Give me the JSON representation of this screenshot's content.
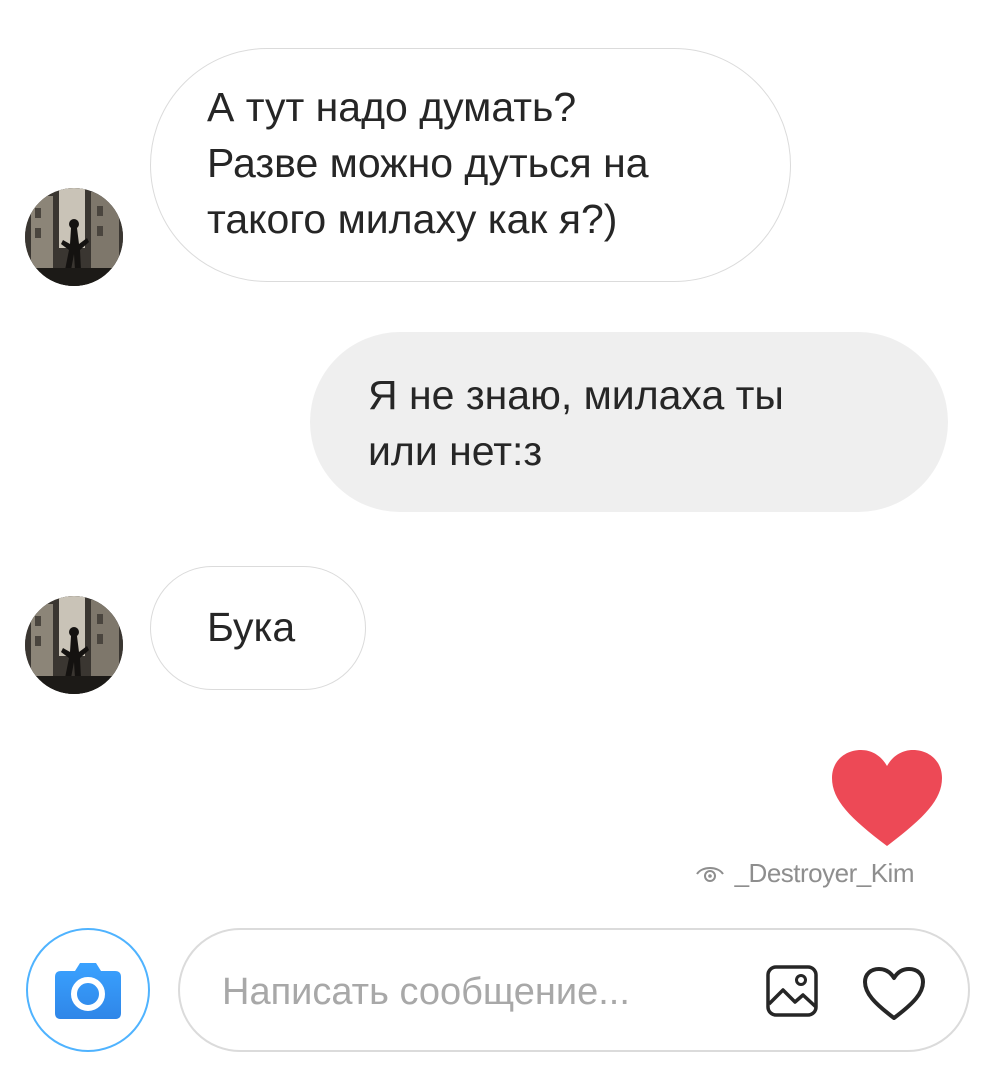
{
  "thread": {
    "messages": [
      {
        "direction": "incoming",
        "text": "А тут надо думать?\nРазве можно дуться на\nтакого милаху как я?)"
      },
      {
        "direction": "outgoing",
        "text": "Я не знаю, милаха ты\nили нет:з"
      },
      {
        "direction": "incoming",
        "text": "Бука"
      }
    ],
    "reaction": {
      "icon": "heart-filled-icon",
      "color": "#ed4956"
    },
    "seen": {
      "icon": "eye-icon",
      "username": "_Destroyer_Kim"
    }
  },
  "composer": {
    "placeholder": "Написать сообщение...",
    "value": "",
    "camera_icon": "camera-icon",
    "gallery_icon": "gallery-icon",
    "like_icon": "heart-outline-icon"
  },
  "colors": {
    "camera_accent": "#3897f0",
    "heart": "#ed4956",
    "outgoing_bubble": "#efefef",
    "incoming_border": "#dbdbdb"
  }
}
